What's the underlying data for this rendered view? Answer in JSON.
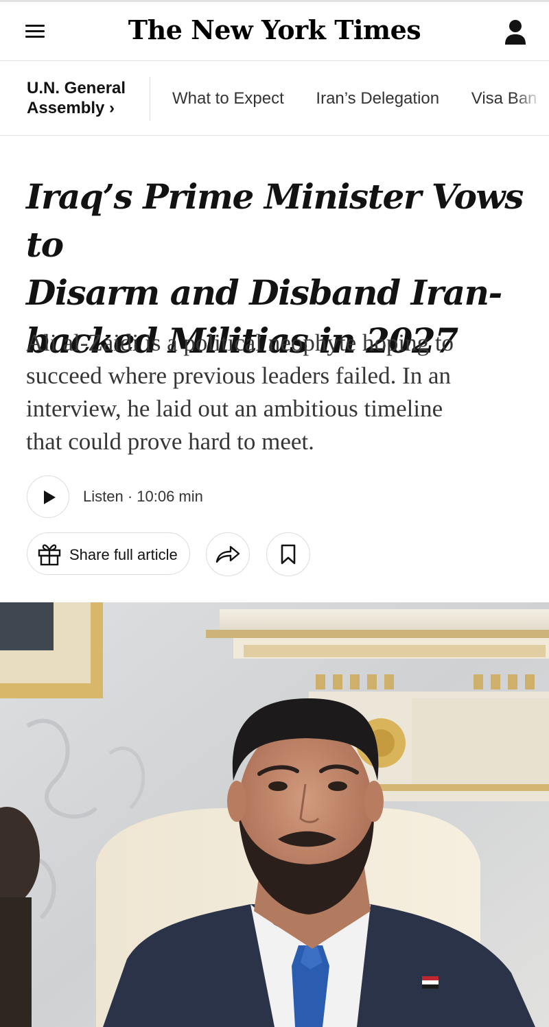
{
  "masthead": {
    "logo_text": "The New York Times",
    "menu_icon": "hamburger-menu-icon",
    "account_icon": "user-account-icon"
  },
  "section_nav": {
    "section_name_line1": "U.N. General",
    "section_name_line2": "Assembly ›",
    "links": [
      "What to Expect",
      "Iran’s Delegation",
      "Visa Ban o"
    ]
  },
  "article": {
    "headline_line1": "Iraq’s Prime Minister Vows to",
    "headline_line2": "Disarm and Disband Iran-",
    "headline_line3": "backed Militias in 2027",
    "summary_line1": "Ali al-Zaidi is a political neophyte hoping to",
    "summary_line2": "succeed where previous leaders failed. In an",
    "summary_line3": "interview, he laid out an ambitious timeline",
    "summary_line4": "that could prove hard to meet."
  },
  "audio": {
    "listen_label": "Listen · 10:06 min",
    "play_icon": "play-icon"
  },
  "share": {
    "share_label": "Share full article",
    "gift_icon": "gift-icon",
    "share_icon": "share-arrow-icon",
    "save_icon": "bookmark-icon"
  },
  "colors": {
    "text": "#121212",
    "border": "#dcdcdc",
    "accent_line": "#326891"
  }
}
